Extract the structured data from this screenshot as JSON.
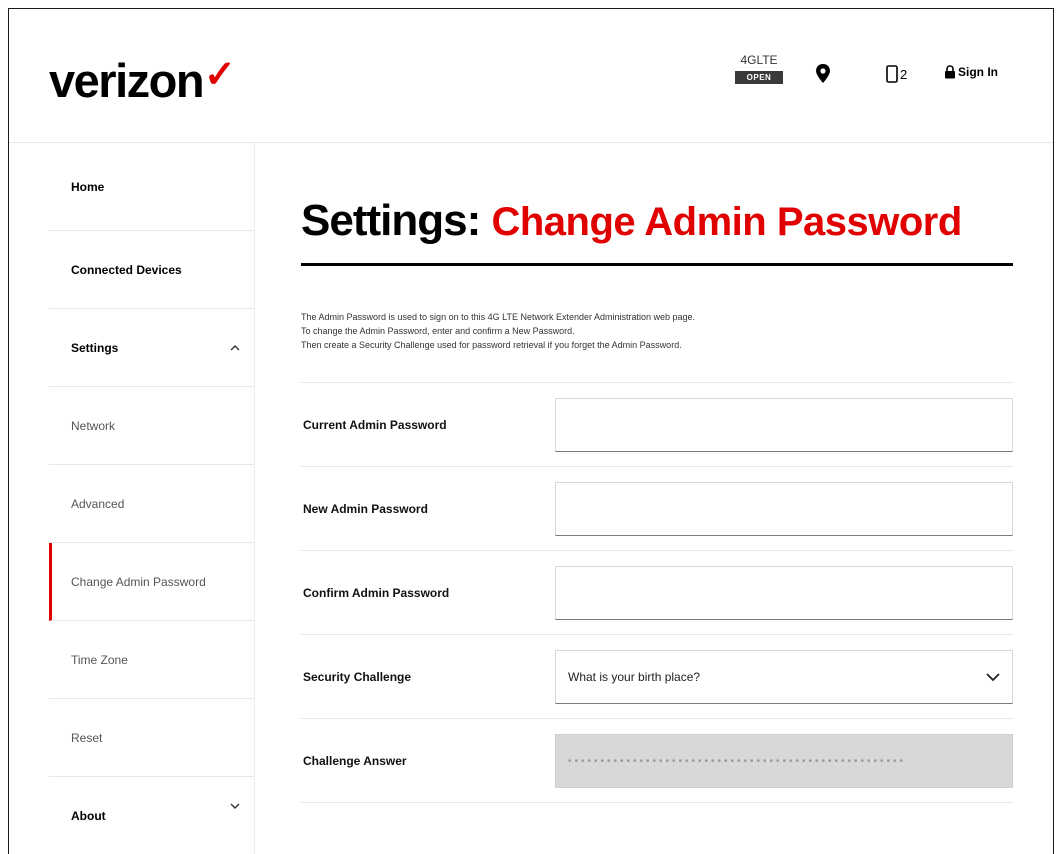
{
  "header": {
    "logo_text": "verizon",
    "network_label": "4GLTE",
    "network_badge": "OPEN",
    "devices_count": "2",
    "signin_label": "Sign In"
  },
  "sidebar": {
    "items": [
      {
        "label": "Home"
      },
      {
        "label": "Connected Devices"
      },
      {
        "label": "Settings"
      },
      {
        "label": "Network"
      },
      {
        "label": "Advanced"
      },
      {
        "label": "Change Admin Password"
      },
      {
        "label": "Time Zone"
      },
      {
        "label": "Reset"
      },
      {
        "label": "About"
      }
    ]
  },
  "main": {
    "title_prefix": "Settings:",
    "title_suffix": "Change Admin Password",
    "intro": [
      "The Admin Password is used to sign on to this 4G LTE Network Extender Administration web page.",
      "To change the Admin Password, enter and confirm a New Password.",
      "Then create a Security Challenge used for password retrieval if you forget the Admin Password."
    ],
    "form": {
      "current_label": "Current Admin Password",
      "new_label": "New Admin Password",
      "confirm_label": "Confirm Admin Password",
      "challenge_label": "Security Challenge",
      "challenge_value": "What is your birth place?",
      "answer_label": "Challenge Answer",
      "answer_value": "••••••••••••••••••••••••••••••••••••••••••••••••••••"
    }
  },
  "colors": {
    "accent": "#e00000",
    "text": "#000000",
    "disabled_field": "#d8d8d8"
  }
}
